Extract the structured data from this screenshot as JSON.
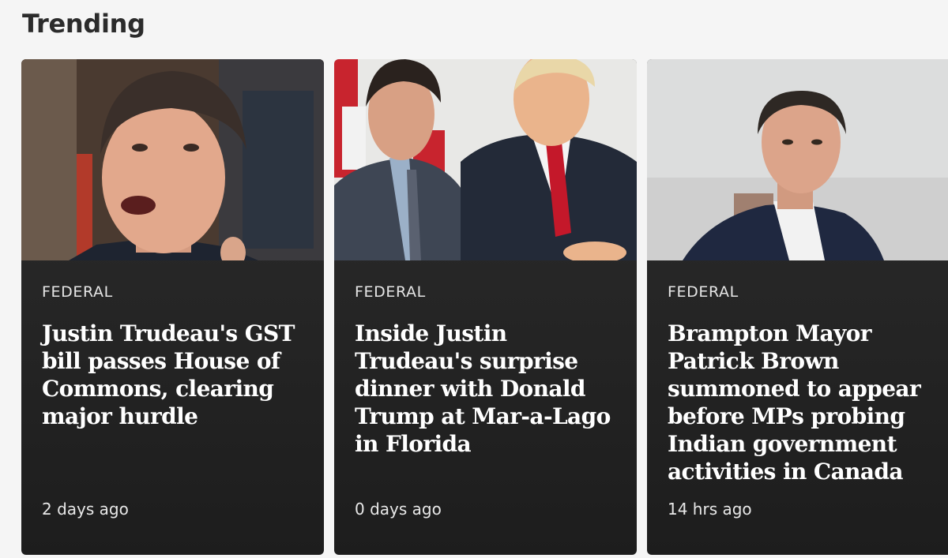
{
  "section": {
    "title": "Trending"
  },
  "cards": [
    {
      "image_alt": "Man speaking in parliament",
      "category": "FEDERAL",
      "headline": "Justin Trudeau's GST bill passes House of Commons, clearing major hurdle",
      "timestamp": "2 days ago"
    },
    {
      "image_alt": "Two men in suits standing together",
      "category": "FEDERAL",
      "headline": "Inside Justin Trudeau's surprise dinner with Donald Trump at Mar-a-Lago in Florida",
      "timestamp": "0 days ago"
    },
    {
      "image_alt": "Man in dark coat outdoors",
      "category": "FEDERAL",
      "headline": "Brampton Mayor Patrick Brown summoned to appear before MPs probing Indian government activities in Canada",
      "timestamp": "14 hrs ago"
    }
  ],
  "colors": {
    "page_background": "#f5f5f5",
    "card_background": "#262626",
    "title_text": "#2b2b2b",
    "card_text": "#ffffff"
  }
}
